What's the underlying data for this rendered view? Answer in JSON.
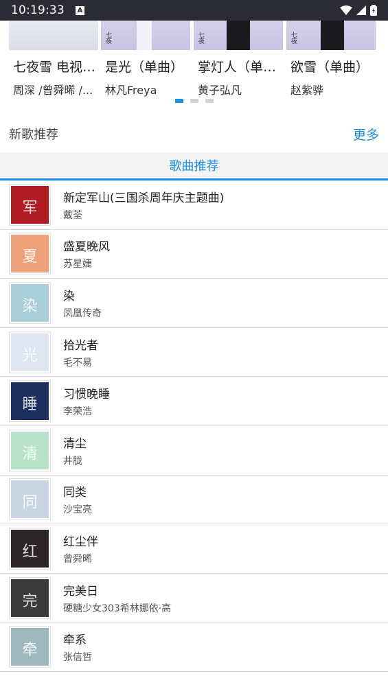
{
  "status_bar": {
    "time": "10:19:33",
    "notification_glyph": "A"
  },
  "carousel": {
    "cards": [
      {
        "title": "七夜雪 电视剧原声带",
        "artist": "周深 /曾舜晞 /..."
      },
      {
        "title": "是光（单曲）",
        "artist": "林凡Freya"
      },
      {
        "title": "掌灯人（单曲）",
        "artist": "黄子弘凡"
      },
      {
        "title": "欲雪（单曲）",
        "artist": "赵紫骅"
      }
    ],
    "page_count": 3,
    "active_page": 1
  },
  "new_songs": {
    "heading": "新歌推荐",
    "more_label": "更多"
  },
  "tab": {
    "label": "歌曲推荐"
  },
  "songs": [
    {
      "title": "新定军山(三国杀周年庆主题曲)",
      "artist": "戴荃",
      "cover_color": "#b01c22",
      "cover_glyph": "军"
    },
    {
      "title": "盛夏晚风",
      "artist": "苏星婕",
      "cover_color": "#f0a27c",
      "cover_glyph": "夏"
    },
    {
      "title": "染",
      "artist": "凤凰传奇",
      "cover_color": "#a9cfd8",
      "cover_glyph": "染"
    },
    {
      "title": "拾光者",
      "artist": "毛不易",
      "cover_color": "#dfe6f2",
      "cover_glyph": "光"
    },
    {
      "title": "习惯晚睡",
      "artist": "李荣浩",
      "cover_color": "#1d2f5c",
      "cover_glyph": "睡"
    },
    {
      "title": "清尘",
      "artist": "井胧",
      "cover_color": "#b8e3c8",
      "cover_glyph": "清"
    },
    {
      "title": "同类",
      "artist": "沙宝亮",
      "cover_color": "#c9d6e2",
      "cover_glyph": "同"
    },
    {
      "title": "红尘伴",
      "artist": "曾舜晞",
      "cover_color": "#2c2426",
      "cover_glyph": "红"
    },
    {
      "title": "完美日",
      "artist": "硬糖少女303希林娜依·高",
      "cover_color": "#3a3a3a",
      "cover_glyph": "完"
    },
    {
      "title": "牵系",
      "artist": "张信哲",
      "cover_color": "#9fb8be",
      "cover_glyph": "牵"
    }
  ]
}
